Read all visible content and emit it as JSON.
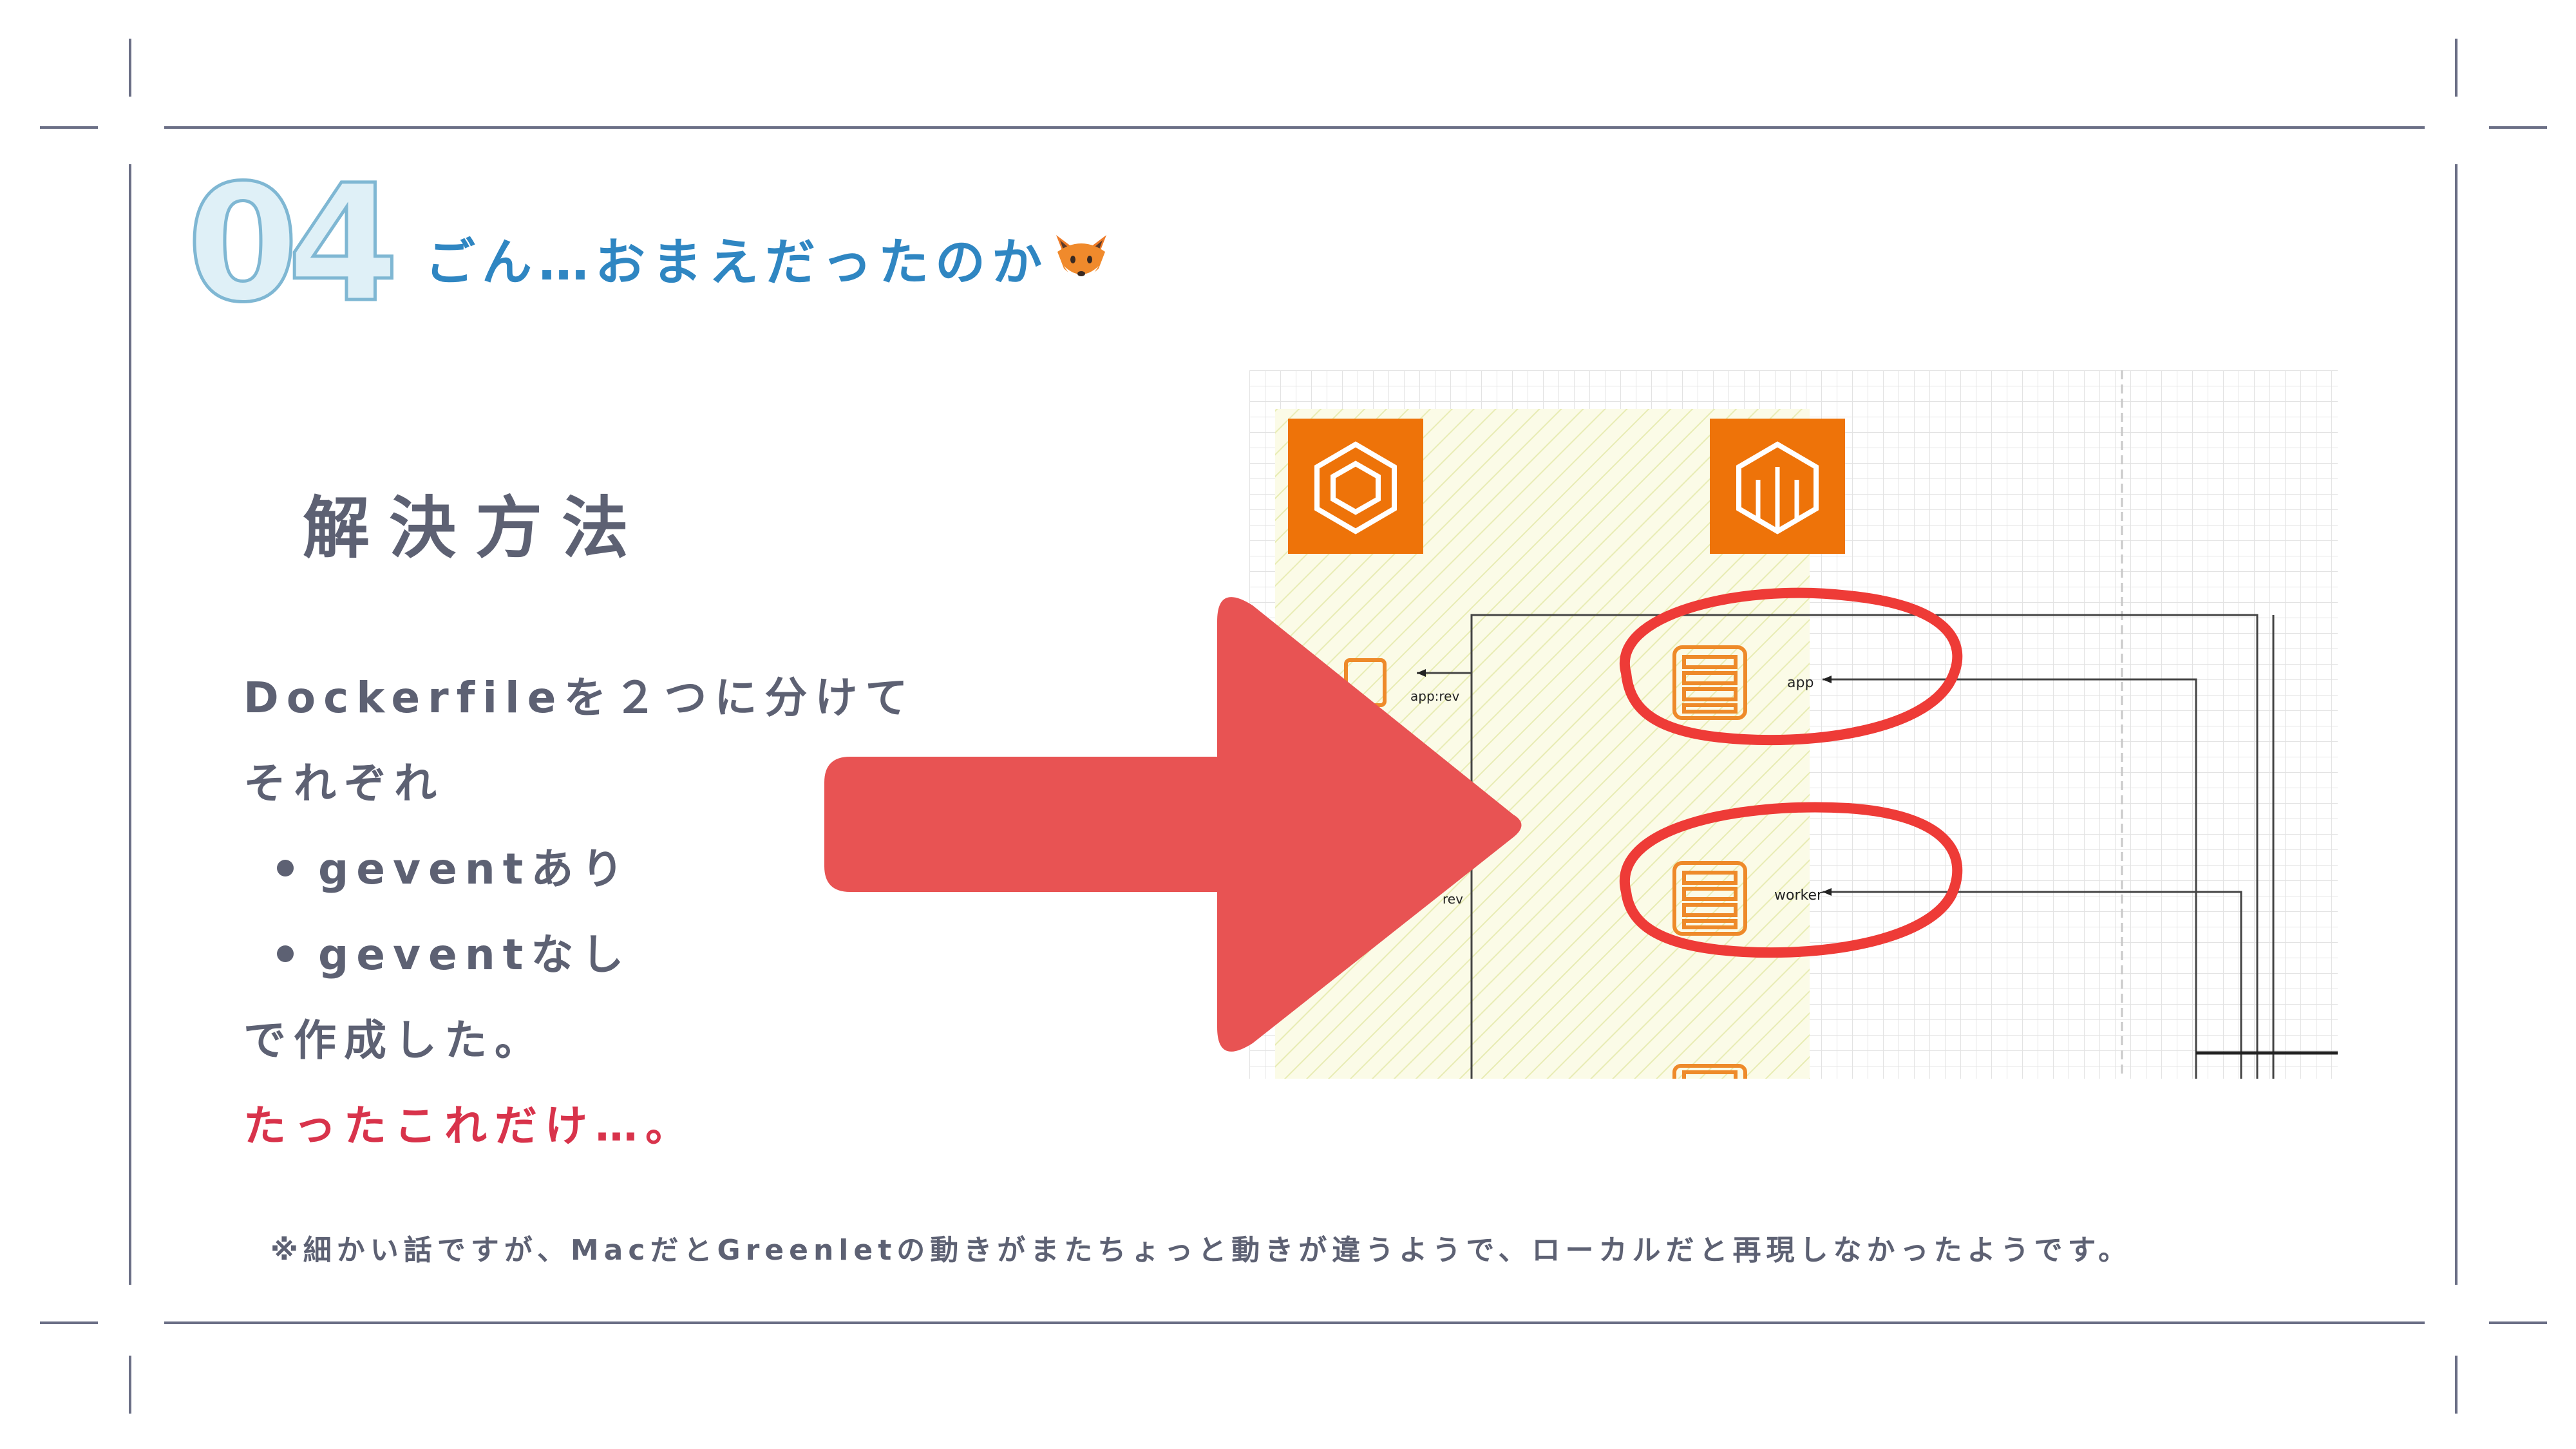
{
  "slide": {
    "number": "04",
    "title": "ごん…おまえだったのか",
    "title_emoji_icon": "fox-face-icon",
    "heading": "解決方法",
    "body_lines": [
      "Dockerfileを２つに分けて",
      "それぞれ"
    ],
    "bullets": [
      "geventあり",
      "geventなし"
    ],
    "after_bullets": "で作成した。",
    "emphasis": "たったこれだけ…。",
    "footnote": "※細かい話ですが、MacだとGreenletの動きがまたちょっと動きが違うようで、ローカルだと再現しなかったようです。"
  },
  "diagram": {
    "labels": {
      "app": "app",
      "worker": "worker",
      "app_rev": "app:rev",
      "rev": "rev"
    },
    "icons": [
      "ecs-cluster-icon",
      "ecs-service-icon",
      "server-task-icon"
    ]
  },
  "colors": {
    "accent_blue": "#2f86c2",
    "text_gray": "#5d6173",
    "emphasis_red": "#d8334b",
    "arrow_red": "#e85353",
    "aws_orange": "#ee7309",
    "circle_red": "#ee3b37"
  }
}
